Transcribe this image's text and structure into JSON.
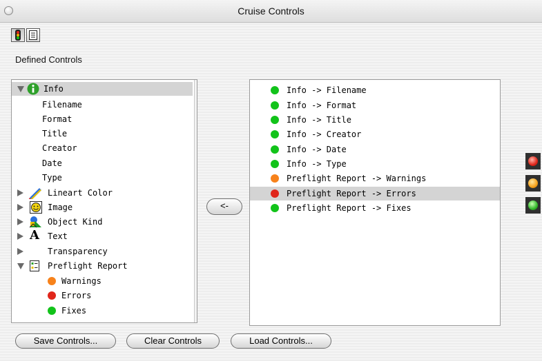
{
  "window": {
    "title": "Cruise Controls"
  },
  "toolbar": {
    "buttons": [
      "traffic-light-icon",
      "report-list-icon"
    ]
  },
  "defined_label": "Defined Controls",
  "tree": {
    "info": "Info",
    "info_children": [
      "Filename",
      "Format",
      "Title",
      "Creator",
      "Date",
      "Type"
    ],
    "lineart": "Lineart Color",
    "image": "Image",
    "object_kind": "Object Kind",
    "text": "Text",
    "transparency": "Transparency",
    "preflight": "Preflight Report",
    "preflight_children": [
      "Warnings",
      "Errors",
      "Fixes"
    ]
  },
  "arrow_button": "<-",
  "controls": [
    {
      "label": "Info -> Filename",
      "status": "green"
    },
    {
      "label": "Info -> Format",
      "status": "green"
    },
    {
      "label": "Info -> Title",
      "status": "green"
    },
    {
      "label": "Info -> Creator",
      "status": "green"
    },
    {
      "label": "Info -> Date",
      "status": "green"
    },
    {
      "label": "Info -> Type",
      "status": "green"
    },
    {
      "label": "Preflight Report -> Warnings",
      "status": "orange"
    },
    {
      "label": "Preflight Report -> Errors",
      "status": "red"
    },
    {
      "label": "Preflight Report -> Fixes",
      "status": "green"
    }
  ],
  "selected_control": "Preflight Report -> Errors",
  "buttons": {
    "save": "Save Controls...",
    "clear": "Clear Controls",
    "load": "Load Controls..."
  },
  "colors": {
    "green": "#12c31a",
    "orange": "#f7821b",
    "red": "#e0261b",
    "selection": "#d4d4d4"
  }
}
